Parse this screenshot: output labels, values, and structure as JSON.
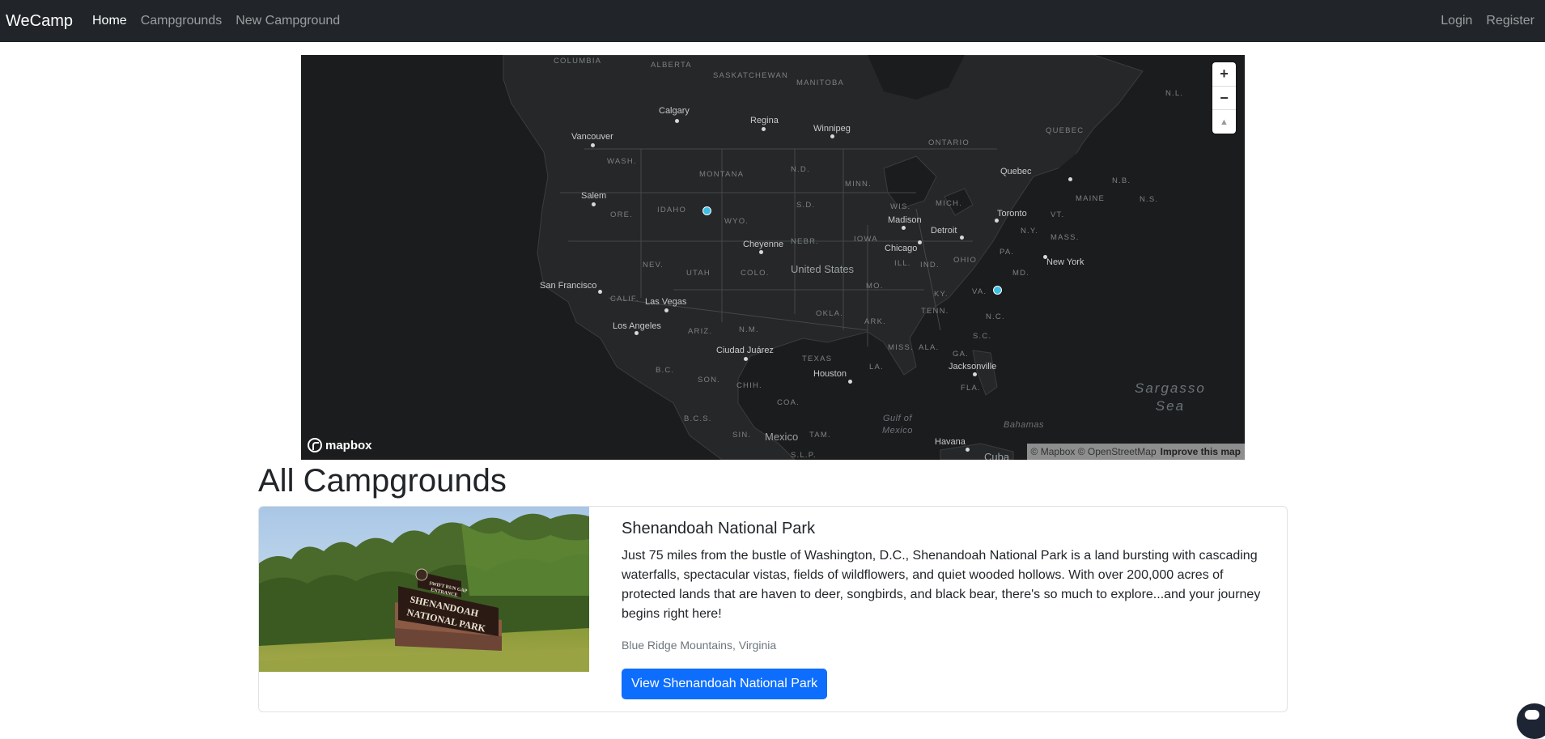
{
  "navbar": {
    "brand": "WeCamp",
    "links": [
      "Home",
      "Campgrounds",
      "New Campground"
    ],
    "right_links": [
      "Login",
      "Register"
    ]
  },
  "map": {
    "provider": "mapbox",
    "attribution": "© Mapbox © OpenStreetMap",
    "improve_link": "Improve this map",
    "controls": {
      "zoom_in": "+",
      "zoom_out": "−",
      "compass": "▲"
    },
    "states": [
      "COLUMBIA",
      "ALBERTA",
      "SASKATCHEWAN",
      "MANITOBA",
      "ONTARIO",
      "QUEBEC",
      "N.L.",
      "WASH.",
      "MONTANA",
      "N.D.",
      "MINN.",
      "ORE.",
      "IDAHO",
      "WYO.",
      "S.D.",
      "WIS.",
      "MICH.",
      "NEV.",
      "UTAH",
      "COLO.",
      "NEBR.",
      "IOWA",
      "ILL.",
      "IND.",
      "OHIO",
      "PA.",
      "N.Y.",
      "VT.",
      "MAINE",
      "N.B.",
      "N.S.",
      "MASS.",
      "CALIF.",
      "ARIZ.",
      "N.M.",
      "OKLA.",
      "MO.",
      "KY.",
      "TENN.",
      "ARK.",
      "N.C.",
      "S.C.",
      "GA.",
      "ALA.",
      "MISS.",
      "LA.",
      "TEXAS",
      "FLA.",
      "MD.",
      "B.C.",
      "SON.",
      "CHIH.",
      "COA.",
      "B.C.S.",
      "SIN.",
      "TAM.",
      "S.L.P.",
      "VA."
    ],
    "cities": [
      "Calgary",
      "Regina",
      "Winnipeg",
      "Vancouver",
      "Quebec",
      "Salem",
      "Toronto",
      "Madison",
      "Detroit",
      "Cheyenne",
      "Chicago",
      "New York",
      "San Francisco",
      "Las Vegas",
      "Los Angeles",
      "Ciudad Juárez",
      "Houston",
      "Jacksonville",
      "Havana"
    ],
    "countries": [
      "United States",
      "Mexico",
      "Cuba"
    ],
    "seas": [
      "Gulf of",
      "Mexico",
      "Bahamas"
    ],
    "ocean_line1": "Sargasso",
    "ocean_line2": "Sea"
  },
  "page": {
    "title": "All Campgrounds"
  },
  "campgrounds": [
    {
      "title": "Shenandoah National Park",
      "description": "Just 75 miles from the bustle of Washington, D.C., Shenandoah National Park is a land bursting with cascading waterfalls, spectacular vistas, fields of wildflowers, and quiet wooded hollows. With over 200,000 acres of protected lands that are haven to deer, songbirds, and black bear, there's so much to explore...and your journey begins right here!",
      "location": "Blue Ridge Mountains, Virginia",
      "button": "View Shenandoah National Park",
      "image_sign": [
        "SWIFT RUN GAP",
        "ENTRANCE",
        "SHENANDOAH",
        "NATIONAL PARK"
      ]
    }
  ],
  "colors": {
    "navbar_bg": "#212529",
    "map_bg": "#1b1c1d",
    "marker": "#3fc0e3",
    "primary_button": "#0d6efd"
  }
}
